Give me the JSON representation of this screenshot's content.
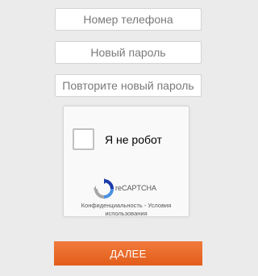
{
  "form": {
    "phone_placeholder": "Номер телефона",
    "new_password_placeholder": "Новый пароль",
    "repeat_password_placeholder": "Повторите новый пароль",
    "submit_label": "ДАЛЕЕ"
  },
  "captcha": {
    "label": "Я не робот",
    "brand": "reCAPTCHA",
    "privacy_link": "Конфиденциальность",
    "separator": " - ",
    "terms_link": "Условия использования",
    "checked": false,
    "logo_icon": "recaptcha-logo-icon"
  },
  "colors": {
    "page_background": "#ebebeb",
    "button_gradient_top": "#f07a3c",
    "button_gradient_bottom": "#e35d1a",
    "recaptcha_blue": "#4a90e2",
    "recaptcha_dark_blue": "#1c3aa9",
    "recaptcha_gray": "#a6a6a6"
  }
}
